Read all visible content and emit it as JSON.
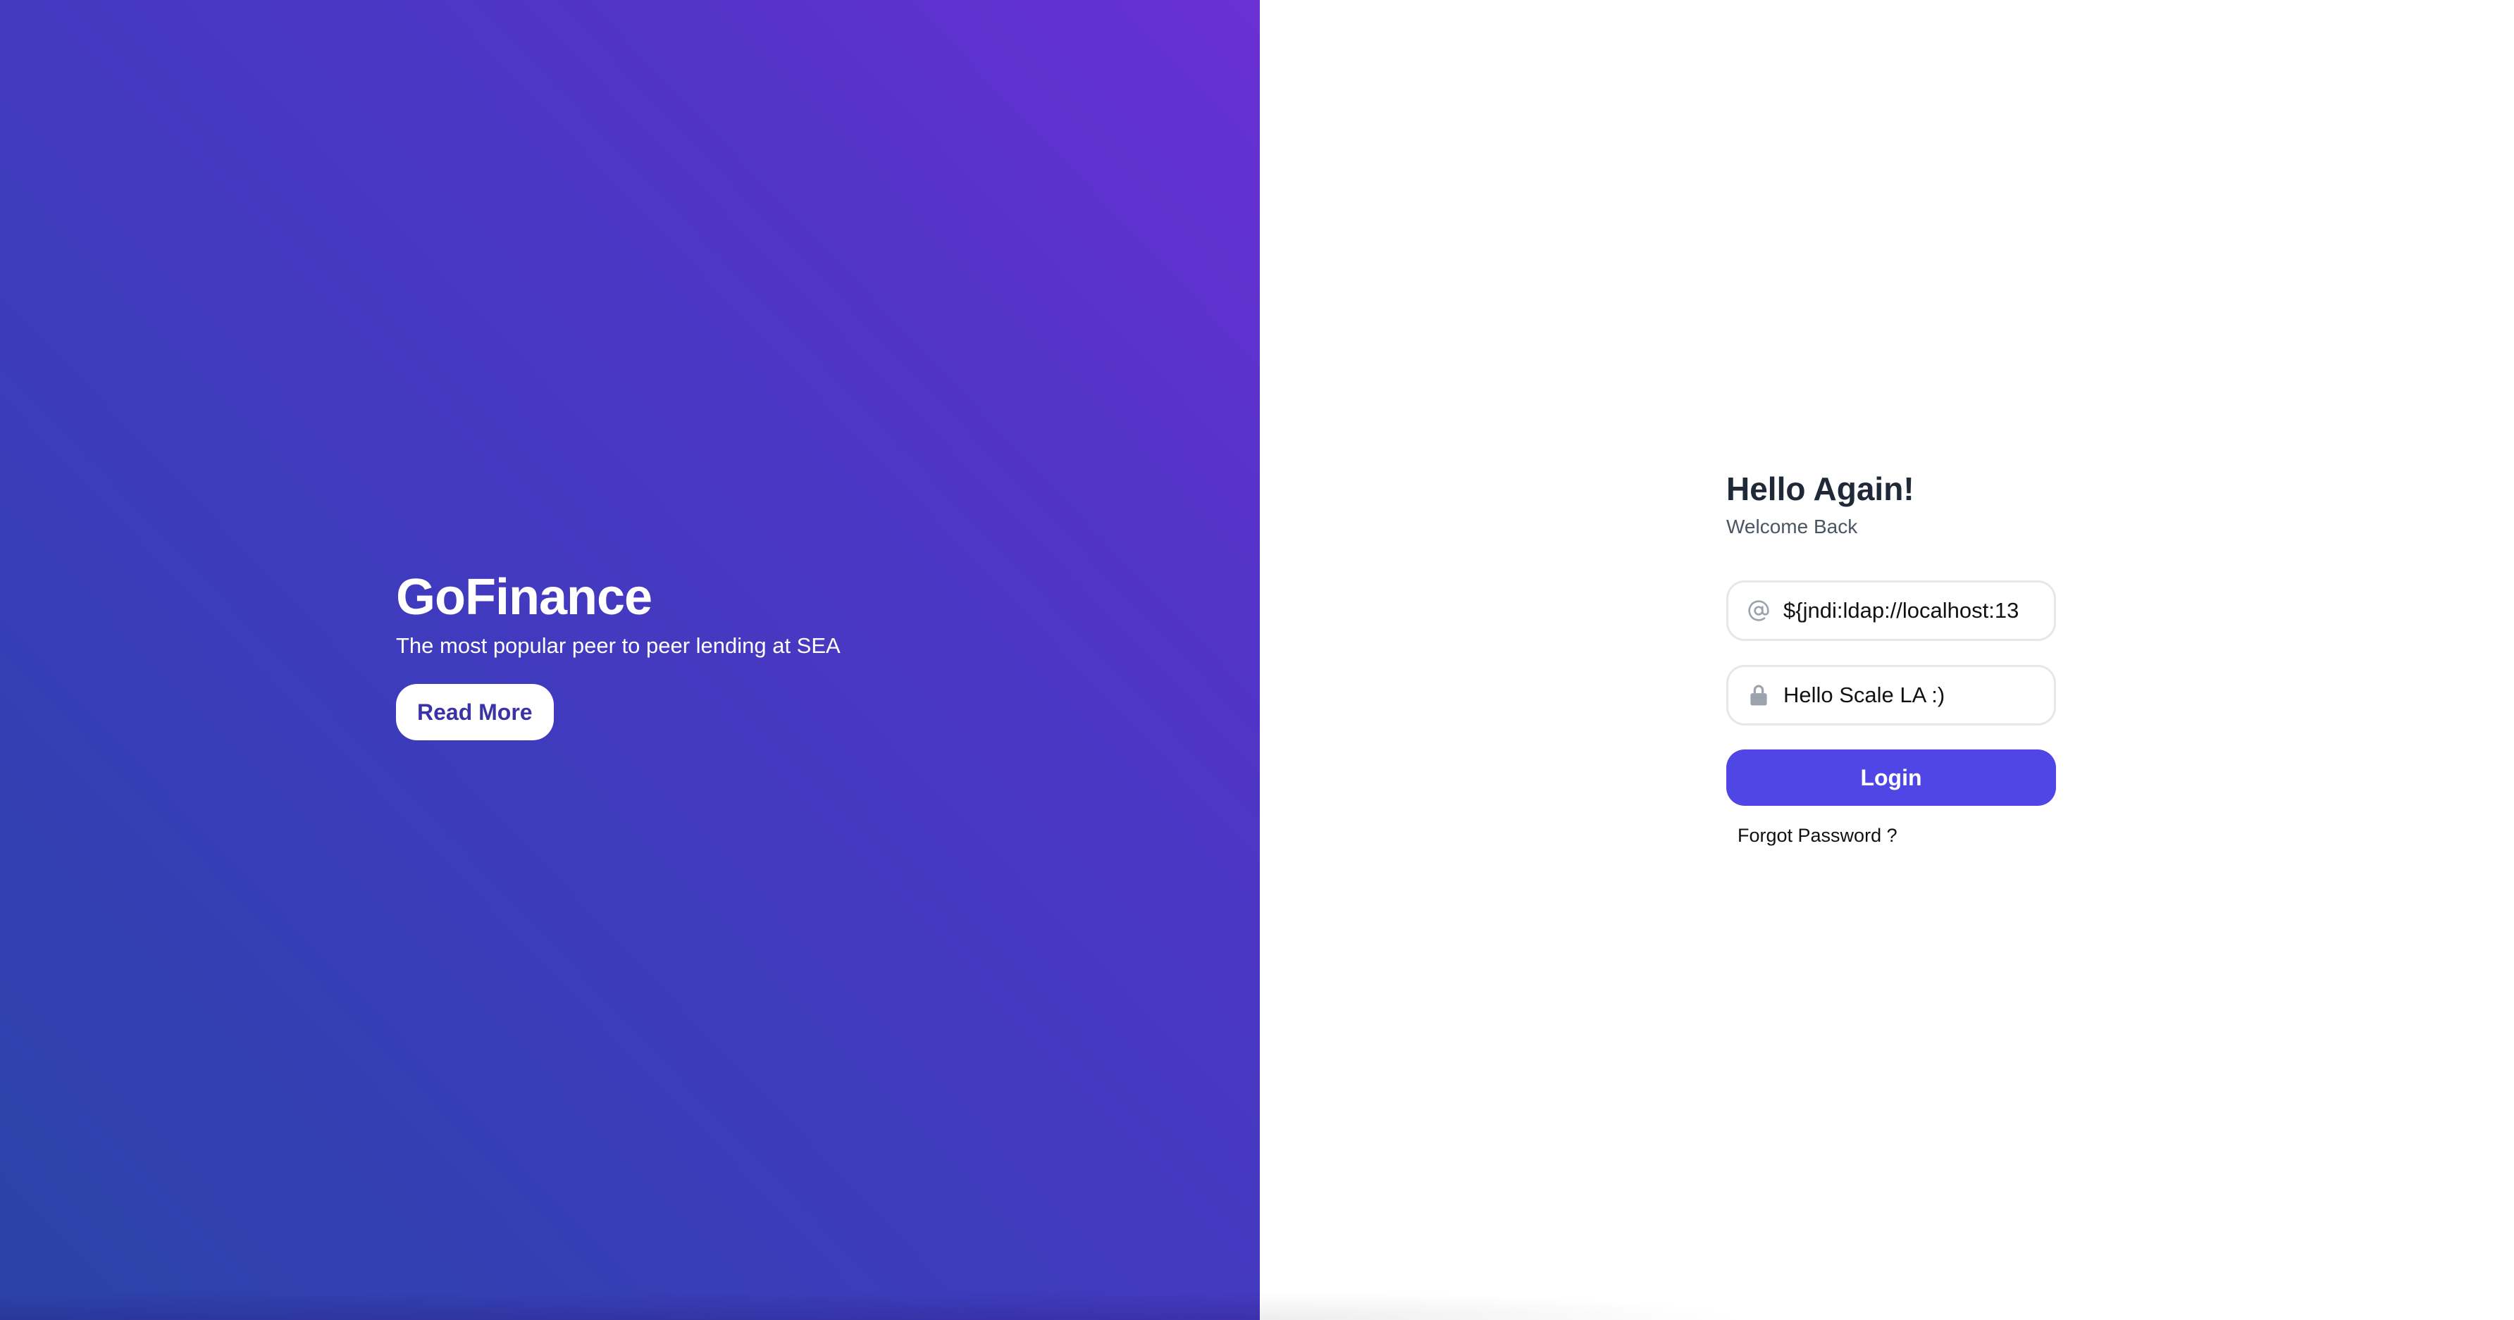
{
  "hero": {
    "brand": "GoFinance",
    "tagline": "The most popular peer to peer lending at SEA",
    "read_more_label": "Read More",
    "gradient_start": "#2a43a8",
    "gradient_end": "#6a30d4"
  },
  "login": {
    "title": "Hello Again!",
    "subtitle": "Welcome Back",
    "email": {
      "icon": "at-sign-icon",
      "value": "${jndi:ldap://localhost:13"
    },
    "password": {
      "icon": "lock-icon",
      "value": "Hello Scale LA :)"
    },
    "login_label": "Login",
    "forgot_label": "Forgot Password ?",
    "accent_color": "#4f46e5"
  }
}
